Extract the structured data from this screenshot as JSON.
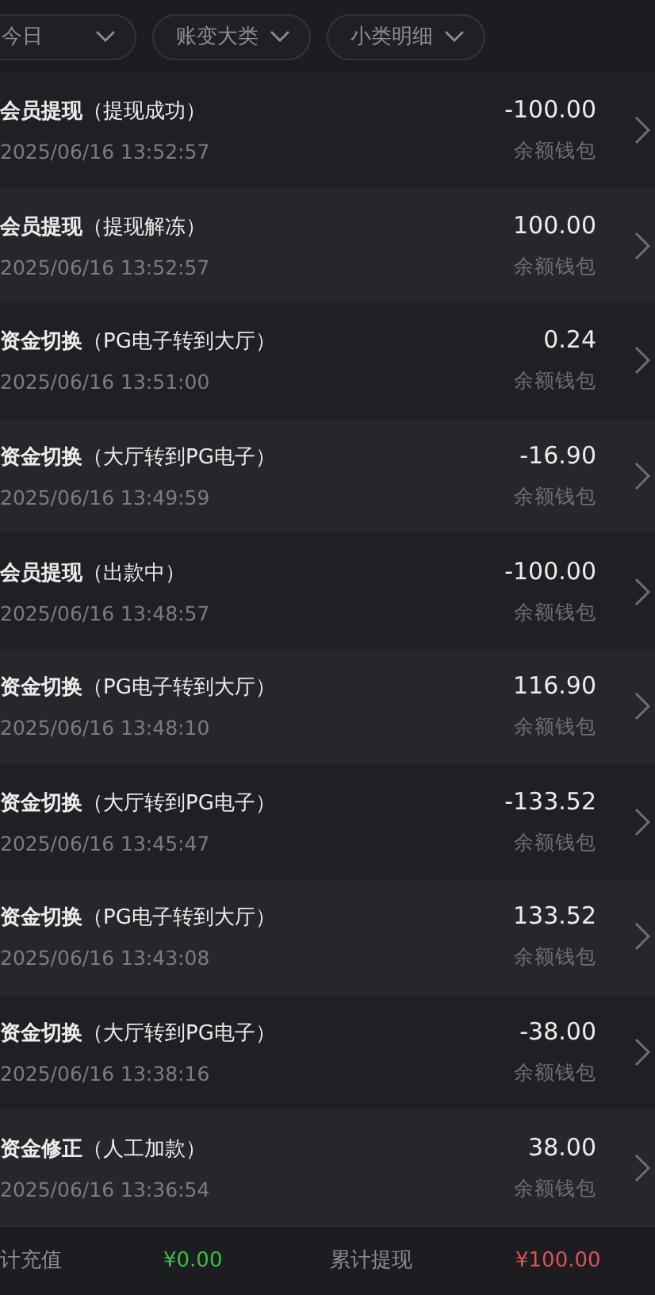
{
  "filters": [
    {
      "label": "今日"
    },
    {
      "label": "账变大类"
    },
    {
      "label": "小类明细"
    }
  ],
  "records": [
    {
      "title": "**会员提现**（提现成功）",
      "time": "2025/06/16 13:52:57",
      "amount": "-100.00",
      "wallet": "余额钱包"
    },
    {
      "title": "**会员提现**（提现解冻）",
      "time": "2025/06/16 13:52:57",
      "amount": "100.00",
      "wallet": "余额钱包"
    },
    {
      "title": "**资金切换**（PG电子转到大厅）",
      "time": "2025/06/16 13:51:00",
      "amount": "0.24",
      "wallet": "余额钱包"
    },
    {
      "title": "**资金切换**（大厅转到PG电子）",
      "time": "2025/06/16 13:49:59",
      "amount": "-16.90",
      "wallet": "余额钱包"
    },
    {
      "title": "**会员提现**（出款中）",
      "time": "2025/06/16 13:48:57",
      "amount": "-100.00",
      "wallet": "余额钱包"
    },
    {
      "title": "**资金切换**（PG电子转到大厅）",
      "time": "2025/06/16 13:48:10",
      "amount": "116.90",
      "wallet": "余额钱包"
    },
    {
      "title": "**资金切换**（大厅转到PG电子）",
      "time": "2025/06/16 13:45:47",
      "amount": "-133.52",
      "wallet": "余额钱包"
    },
    {
      "title": "**资金切换**（PG电子转到大厅）",
      "time": "2025/06/16 13:43:08",
      "amount": "133.52",
      "wallet": "余额钱包"
    },
    {
      "title": "**资金切换**（大厅转到PG电子）",
      "time": "2025/06/16 13:38:16",
      "amount": "-38.00",
      "wallet": "余额钱包"
    },
    {
      "title": "**资金修正**（人工加款）",
      "time": "2025/06/16 13:36:54",
      "amount": "38.00",
      "wallet": "余额钱包"
    }
  ],
  "footer": {
    "deposit_label": "计充值",
    "deposit_value": "¥0.00",
    "withdraw_label": "累计提现",
    "withdraw_value": "¥100.00"
  }
}
